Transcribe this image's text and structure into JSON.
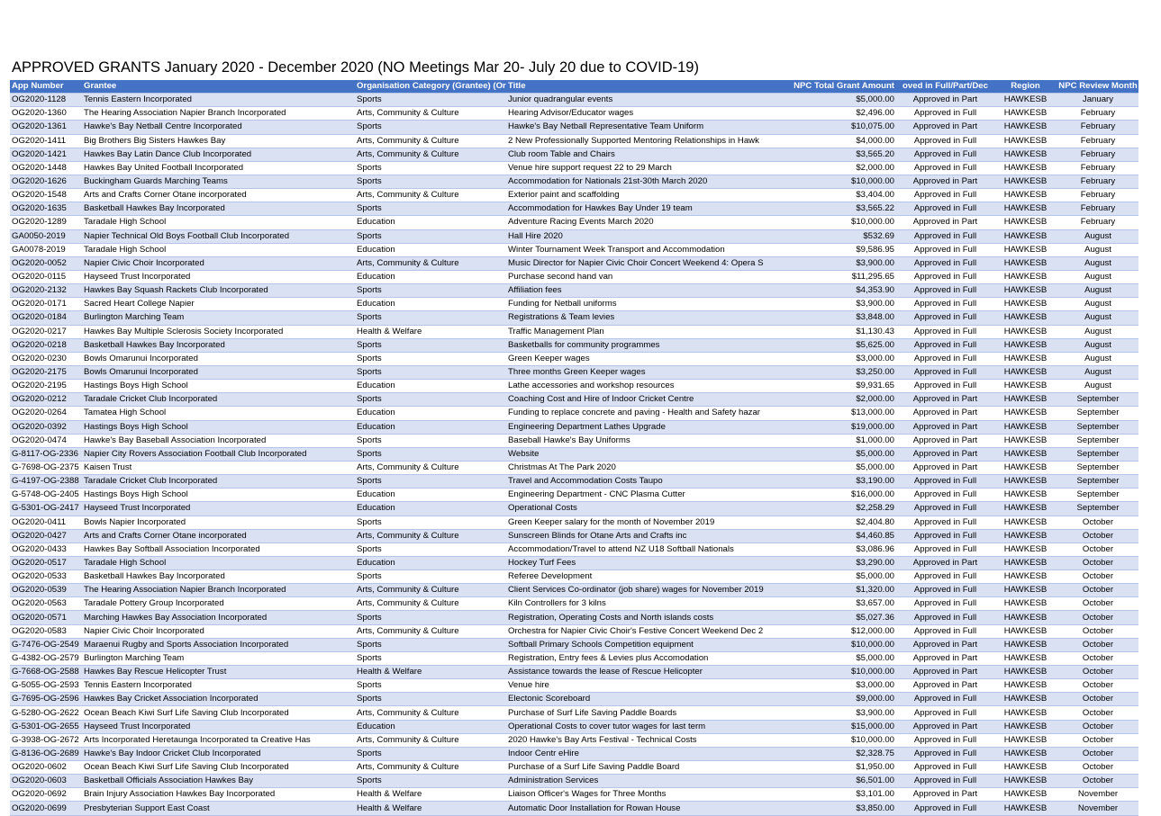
{
  "title": "APPROVED GRANTS January 2020 - December 2020 (NO Meetings Mar 20- July 20 due to COVID-19)",
  "columns": [
    "App Number",
    "Grantee",
    "Organisation Category (Grantee) (Or",
    "Title",
    "NPC Total Grant Amount",
    "oved in Full/Part/Dec",
    "Region",
    "NPC Review Month"
  ],
  "rows": [
    [
      "OG2020-1128",
      "Tennis Eastern Incorporated",
      "Sports",
      "Junior quadrangular events",
      "$5,000.00",
      "Approved in Part",
      "HAWKESB",
      "January"
    ],
    [
      "OG2020-1360",
      "The Hearing Association Napier Branch Incorporated",
      "Arts, Community & Culture",
      "Hearing Advisor/Educator wages",
      "$2,496.00",
      "Approved in Full",
      "HAWKESB",
      "February"
    ],
    [
      "OG2020-1361",
      "Hawke's Bay Netball Centre Incorporated",
      "Sports",
      "Hawke's Bay Netball Representative Team Uniform",
      "$10,075.00",
      "Approved in Part",
      "HAWKESB",
      "February"
    ],
    [
      "OG2020-1411",
      "Big Brothers Big Sisters Hawkes Bay",
      "Arts, Community & Culture",
      "2 New Professionally Supported Mentoring Relationships in Hawk",
      "$4,000.00",
      "Approved in Full",
      "HAWKESB",
      "February"
    ],
    [
      "OG2020-1421",
      "Hawkes Bay Latin Dance Club Incorporated",
      "Arts, Community & Culture",
      "Club room Table and Chairs",
      "$3,565.20",
      "Approved in Full",
      "HAWKESB",
      "February"
    ],
    [
      "OG2020-1448",
      "Hawkes Bay United Football Incorporated",
      "Sports",
      "Venue hire support request 22 to 29 March",
      "$2,000.00",
      "Approved in Full",
      "HAWKESB",
      "February"
    ],
    [
      "OG2020-1626",
      "Buckingham Guards Marching Teams",
      "Sports",
      "Accommodation for Nationals 21st-30th March 2020",
      "$10,000.00",
      "Approved in Part",
      "HAWKESB",
      "February"
    ],
    [
      "OG2020-1548",
      "Arts and Crafts Corner Otane incorporated",
      "Arts, Community & Culture",
      "Exterior paint and scaffolding",
      "$3,404.00",
      "Approved in Full",
      "HAWKESB",
      "February"
    ],
    [
      "OG2020-1635",
      "Basketball Hawkes Bay Incorporated",
      "Sports",
      "Accommodation for Hawkes Bay Under 19 team",
      "$3,565.22",
      "Approved in Full",
      "HAWKESB",
      "February"
    ],
    [
      "OG2020-1289",
      "Taradale High School",
      "Education",
      "Adventure Racing Events March 2020",
      "$10,000.00",
      "Approved in Part",
      "HAWKESB",
      "February"
    ],
    [
      "GA0050-2019",
      "Napier Technical Old Boys Football Club Incorporated",
      "Sports",
      "Hall Hire 2020",
      "$532.69",
      "Approved in Full",
      "HAWKESB",
      "August"
    ],
    [
      "GA0078-2019",
      "Taradale High School",
      "Education",
      "Winter Tournament Week Transport and Accommodation",
      "$9,586.95",
      "Approved in Full",
      "HAWKESB",
      "August"
    ],
    [
      "OG2020-0052",
      "Napier Civic Choir Incorporated",
      "Arts, Community & Culture",
      "Music Director for Napier Civic Choir Concert Weekend 4: Opera S",
      "$3,900.00",
      "Approved in Full",
      "HAWKESB",
      "August"
    ],
    [
      "OG2020-0115",
      "Hayseed Trust Incorporated",
      "Education",
      "Purchase second hand van",
      "$11,295.65",
      "Approved in Full",
      "HAWKESB",
      "August"
    ],
    [
      "OG2020-2132",
      "Hawkes Bay Squash Rackets Club Incorporated",
      "Sports",
      "Affiliation fees",
      "$4,353.90",
      "Approved in Full",
      "HAWKESB",
      "August"
    ],
    [
      "OG2020-0171",
      "Sacred Heart College Napier",
      "Education",
      "Funding for Netball uniforms",
      "$3,900.00",
      "Approved in Full",
      "HAWKESB",
      "August"
    ],
    [
      "OG2020-0184",
      "Burlington Marching Team",
      "Sports",
      "Registrations & Team levies",
      "$3,848.00",
      "Approved in Full",
      "HAWKESB",
      "August"
    ],
    [
      "OG2020-0217",
      "Hawkes Bay Multiple Sclerosis Society Incorporated",
      "Health & Welfare",
      "Traffic Management Plan",
      "$1,130.43",
      "Approved in Full",
      "HAWKESB",
      "August"
    ],
    [
      "OG2020-0218",
      "Basketball Hawkes Bay Incorporated",
      "Sports",
      "Basketballs for community programmes",
      "$5,625.00",
      "Approved in Full",
      "HAWKESB",
      "August"
    ],
    [
      "OG2020-0230",
      "Bowls Omarunui Incorporated",
      "Sports",
      "Green Keeper wages",
      "$3,000.00",
      "Approved in Full",
      "HAWKESB",
      "August"
    ],
    [
      "OG2020-2175",
      "Bowls Omarunui Incorporated",
      "Sports",
      "Three months Green Keeper wages",
      "$3,250.00",
      "Approved in Full",
      "HAWKESB",
      "August"
    ],
    [
      "OG2020-2195",
      "Hastings Boys High School",
      "Education",
      "Lathe accessories and workshop resources",
      "$9,931.65",
      "Approved in Full",
      "HAWKESB",
      "August"
    ],
    [
      "OG2020-0212",
      "Taradale Cricket Club Incorporated",
      "Sports",
      "Coaching Cost and Hire of Indoor Cricket Centre",
      "$2,000.00",
      "Approved in Part",
      "HAWKESB",
      "September"
    ],
    [
      "OG2020-0264",
      "Tamatea High School",
      "Education",
      "Funding to replace concrete and paving - Health and Safety hazar",
      "$13,000.00",
      "Approved in Part",
      "HAWKESB",
      "September"
    ],
    [
      "OG2020-0392",
      "Hastings Boys High School",
      "Education",
      "Engineering Department Lathes Upgrade",
      "$19,000.00",
      "Approved in Part",
      "HAWKESB",
      "September"
    ],
    [
      "OG2020-0474",
      "Hawke's Bay Baseball Association Incorporated",
      "Sports",
      "Baseball Hawke's Bay Uniforms",
      "$1,000.00",
      "Approved in Part",
      "HAWKESB",
      "September"
    ],
    [
      "G-8117-OG-2336",
      "Napier City Rovers Association Football Club Incorporated",
      "Sports",
      "Website",
      "$5,000.00",
      "Approved in Part",
      "HAWKESB",
      "September"
    ],
    [
      "G-7698-OG-2375",
      "Kaisen Trust",
      "Arts, Community & Culture",
      "Christmas At The Park 2020",
      "$5,000.00",
      "Approved in Part",
      "HAWKESB",
      "September"
    ],
    [
      "G-4197-OG-2388",
      "Taradale Cricket Club Incorporated",
      "Sports",
      "Travel and Accommodation Costs Taupo",
      "$3,190.00",
      "Approved in Full",
      "HAWKESB",
      "September"
    ],
    [
      "G-5748-OG-2405",
      "Hastings Boys High School",
      "Education",
      "Engineering Department - CNC Plasma Cutter",
      "$16,000.00",
      "Approved in Full",
      "HAWKESB",
      "September"
    ],
    [
      "G-5301-OG-2417",
      "Hayseed Trust Incorporated",
      "Education",
      "Operational Costs",
      "$2,258.29",
      "Approved in Full",
      "HAWKESB",
      "September"
    ],
    [
      "OG2020-0411",
      "Bowls Napier Incorporated",
      "Sports",
      "Green Keeper salary for the month of November 2019",
      "$2,404.80",
      "Approved in Full",
      "HAWKESB",
      "October"
    ],
    [
      "OG2020-0427",
      "Arts and Crafts Corner Otane incorporated",
      "Arts, Community & Culture",
      "Sunscreen Blinds for Otane Arts and Crafts inc",
      "$4,460.85",
      "Approved in Full",
      "HAWKESB",
      "October"
    ],
    [
      "OG2020-0433",
      "Hawkes Bay Softball Association Incorporated",
      "Sports",
      "Accommodation/Travel to attend NZ U18 Softball Nationals",
      "$3,086.96",
      "Approved in Full",
      "HAWKESB",
      "October"
    ],
    [
      "OG2020-0517",
      "Taradale High School",
      "Education",
      "Hockey Turf Fees",
      "$3,290.00",
      "Approved in Part",
      "HAWKESB",
      "October"
    ],
    [
      "OG2020-0533",
      "Basketball Hawkes Bay Incorporated",
      "Sports",
      "Referee Development",
      "$5,000.00",
      "Approved in Full",
      "HAWKESB",
      "October"
    ],
    [
      "OG2020-0539",
      "The Hearing Association Napier Branch Incorporated",
      "Arts, Community & Culture",
      "Client Services Co-ordinator (job share) wages for November 2019",
      "$1,320.00",
      "Approved in Full",
      "HAWKESB",
      "October"
    ],
    [
      "OG2020-0563",
      "Taradale Pottery Group Incorporated",
      "Arts, Community & Culture",
      "Kiln Controllers for 3 kilns",
      "$3,657.00",
      "Approved in Full",
      "HAWKESB",
      "October"
    ],
    [
      "OG2020-0571",
      "Marching Hawkes Bay Association Incorporated",
      "Sports",
      "Registration, Operating Costs and North islands costs",
      "$5,027.36",
      "Approved in Full",
      "HAWKESB",
      "October"
    ],
    [
      "OG2020-0583",
      "Napier Civic Choir Incorporated",
      "Arts, Community & Culture",
      "Orchestra for Napier Civic Choir's Festive Concert Weekend Dec 2",
      "$12,000.00",
      "Approved in Full",
      "HAWKESB",
      "October"
    ],
    [
      "G-7476-OG-2549",
      "Maraenui Rugby and Sports Association Incorporated",
      "Sports",
      "Softball Primary Schools Competition equipment",
      "$10,000.00",
      "Approved in Part",
      "HAWKESB",
      "October"
    ],
    [
      "G-4382-OG-2579",
      "Burlington Marching Team",
      "Sports",
      "Registration, Entry fees & Levies plus Accomodation",
      "$5,000.00",
      "Approved in Part",
      "HAWKESB",
      "October"
    ],
    [
      "G-7668-OG-2588",
      "Hawkes Bay Rescue Helicopter Trust",
      "Health & Welfare",
      "Assistance towards the lease of Rescue Helicopter",
      "$10,000.00",
      "Approved in Part",
      "HAWKESB",
      "October"
    ],
    [
      "G-5055-OG-2593",
      "Tennis Eastern Incorporated",
      "Sports",
      "Venue hire",
      "$3,000.00",
      "Approved in Part",
      "HAWKESB",
      "October"
    ],
    [
      "G-7695-OG-2596",
      "Hawkes Bay Cricket Association Incorporated",
      "Sports",
      "Electonic Scoreboard",
      "$9,000.00",
      "Approved in Full",
      "HAWKESB",
      "October"
    ],
    [
      "G-5280-OG-2622",
      "Ocean Beach Kiwi Surf Life Saving Club Incorporated",
      "Arts, Community & Culture",
      "Purchase of Surf Life Saving Paddle Boards",
      "$3,900.00",
      "Approved in Full",
      "HAWKESB",
      "October"
    ],
    [
      "G-5301-OG-2655",
      "Hayseed Trust Incorporated",
      "Education",
      "Operational Costs to cover tutor wages for last term",
      "$15,000.00",
      "Approved in Part",
      "HAWKESB",
      "October"
    ],
    [
      "G-3938-OG-2672",
      "Arts Incorporated Heretaunga Incorporated ta Creative Has",
      "Arts, Community & Culture",
      "2020 Hawke's Bay Arts Festival - Technical Costs",
      "$10,000.00",
      "Approved in Full",
      "HAWKESB",
      "October"
    ],
    [
      "G-8136-OG-2689",
      "Hawke's Bay Indoor Cricket Club Incorporated",
      "Sports",
      "Indoor Centr eHire",
      "$2,328.75",
      "Approved in Full",
      "HAWKESB",
      "October"
    ],
    [
      "OG2020-0602",
      "Ocean Beach Kiwi Surf Life Saving Club Incorporated",
      "Arts, Community & Culture",
      "Purchase of a Surf Life Saving Paddle Board",
      "$1,950.00",
      "Approved in Full",
      "HAWKESB",
      "October"
    ],
    [
      "OG2020-0603",
      "Basketball Officials Association Hawkes Bay",
      "Sports",
      "Administration Services",
      "$6,501.00",
      "Approved in Full",
      "HAWKESB",
      "October"
    ],
    [
      "OG2020-0692",
      "Brain Injury Association Hawkes Bay Incorporated",
      "Health & Welfare",
      "Liaison Officer's Wages for Three Months",
      "$3,101.00",
      "Approved in Part",
      "HAWKESB",
      "November"
    ],
    [
      "OG2020-0699",
      "Presbyterian Support East Coast",
      "Health & Welfare",
      "Automatic Door Installation for Rowan House",
      "$3,850.00",
      "Approved in Full",
      "HAWKESB",
      "November"
    ]
  ]
}
